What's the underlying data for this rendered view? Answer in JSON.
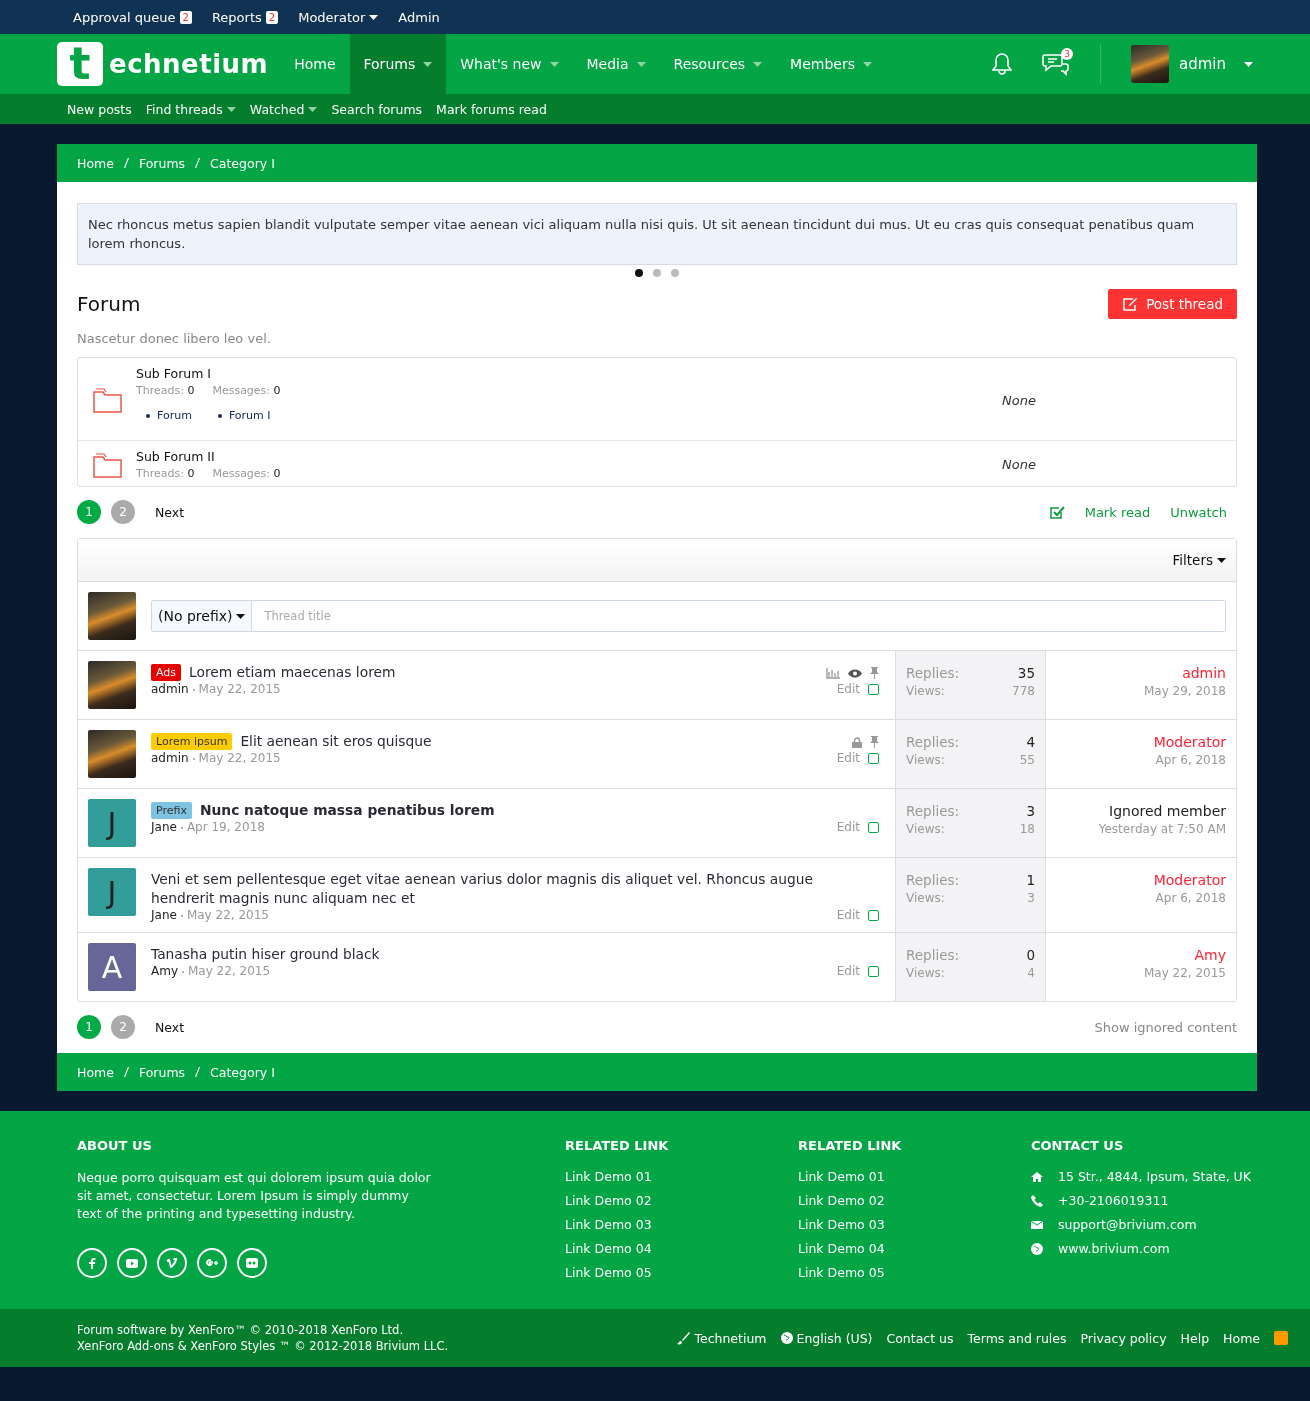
{
  "staff_bar": [
    {
      "label": "Approval queue",
      "badge": "2",
      "dropdown": false
    },
    {
      "label": "Reports",
      "badge": "2",
      "dropdown": false
    },
    {
      "label": "Moderator",
      "dropdown": true
    },
    {
      "label": "Admin",
      "dropdown": false
    }
  ],
  "header": {
    "logo_letter": "t",
    "logo_text": "echnetium",
    "nav": [
      {
        "label": "Home",
        "selected": false,
        "dropdown": false
      },
      {
        "label": "Forums",
        "selected": true,
        "dropdown": true
      },
      {
        "label": "What's new",
        "selected": false,
        "dropdown": true
      },
      {
        "label": "Media",
        "selected": false,
        "dropdown": true
      },
      {
        "label": "Resources",
        "selected": false,
        "dropdown": true
      },
      {
        "label": "Members",
        "selected": false,
        "dropdown": true
      }
    ],
    "conversations_badge": "3",
    "user": "admin"
  },
  "subnav": [
    {
      "label": "New posts",
      "dropdown": false
    },
    {
      "label": "Find threads",
      "dropdown": true
    },
    {
      "label": "Watched",
      "dropdown": true
    },
    {
      "label": "Search forums",
      "dropdown": false
    },
    {
      "label": "Mark forums read",
      "dropdown": false
    }
  ],
  "breadcrumb_top": [
    "Home",
    "Forums",
    "Category I"
  ],
  "notice": {
    "text": "Nec rhoncus metus sapien blandit vulputate semper vitae aenean vici aliquam nulla nisi quis. Ut sit aenean tincidunt dui mus. Ut eu cras quis consequat penatibus quam lorem rhoncus.",
    "dots": [
      {
        "selected": true
      },
      {
        "selected": false
      },
      {
        "selected": false
      }
    ]
  },
  "forum": {
    "title": "Forum",
    "description": "Nascetur donec libero leo vel.",
    "post_button": "Post thread"
  },
  "subforums": [
    {
      "title": "Sub Forum I",
      "threads_label": "Threads:",
      "threads": "0",
      "messages_label": "Messages:",
      "messages": "0",
      "links": [
        "Forum",
        "Forum I"
      ],
      "last_post": "None"
    },
    {
      "title": "Sub Forum II",
      "threads_label": "Threads:",
      "threads": "0",
      "messages_label": "Messages:",
      "messages": "0",
      "last_post": "None"
    }
  ],
  "pagination_top": {
    "pages": [
      {
        "label": "1",
        "selected": true
      },
      {
        "label": "2",
        "selected": false
      }
    ],
    "next": "Next"
  },
  "actions": [
    "Mark read",
    "Unwatch"
  ],
  "filters": "Filters",
  "new_thread": {
    "prefix": "(No prefix)",
    "placeholder": "Thread title"
  },
  "threads": [
    {
      "avatar": {
        "kind": "photo"
      },
      "prefix": {
        "label": "Ads",
        "color": "#e60000"
      },
      "title": "Lorem etiam maecenas lorem",
      "unread": false,
      "author": "admin",
      "date": "May 22, 2015",
      "poll": true,
      "watched": true,
      "locked": false,
      "sticky": true,
      "edit": "Edit",
      "checked": false,
      "replies_label": "Replies:",
      "replies": "35",
      "views_label": "Views:",
      "views": "778",
      "last_user": "admin",
      "last_staff": true,
      "last_date": "May 29, 2018"
    },
    {
      "avatar": {
        "kind": "photo"
      },
      "prefix": {
        "label": "Lorem ipsum",
        "color": "#ffcc00"
      },
      "title": "Elit aenean sit eros quisque",
      "unread": false,
      "author": "admin",
      "date": "May 22, 2015",
      "poll": false,
      "watched": false,
      "locked": true,
      "sticky": true,
      "edit": "Edit",
      "checked": false,
      "replies_label": "Replies:",
      "replies": "4",
      "views_label": "Views:",
      "views": "55",
      "last_user": "Moderator",
      "last_staff": true,
      "last_date": "Apr 6, 2018"
    },
    {
      "avatar": {
        "kind": "letter",
        "letter": "J",
        "color": "#339e99"
      },
      "prefix": {
        "label": "Prefix",
        "color": "#7fc3e2"
      },
      "title": "Nunc natoque massa penatibus lorem",
      "unread": true,
      "author": "Jane",
      "date": "Apr 19, 2018",
      "poll": false,
      "watched": false,
      "locked": false,
      "sticky": false,
      "edit": "Edit",
      "checked": false,
      "replies_label": "Replies:",
      "replies": "3",
      "views_label": "Views:",
      "views": "18",
      "last_user": "Ignored member",
      "last_staff": false,
      "last_date": "Yesterday at 7:50 AM"
    },
    {
      "avatar": {
        "kind": "letter",
        "letter": "J",
        "color": "#339e99"
      },
      "title": "Veni et sem pellentesque eget vitae aenean varius dolor magnis dis aliquet vel. Rhoncus augue hendrerit magnis nunc aliquam nec et",
      "unread": false,
      "author": "Jane",
      "date": "May 22, 2015",
      "poll": false,
      "watched": false,
      "locked": false,
      "sticky": false,
      "edit": "Edit",
      "checked": false,
      "replies_label": "Replies:",
      "replies": "1",
      "views_label": "Views:",
      "views": "3",
      "last_user": "Moderator",
      "last_staff": true,
      "last_date": "Apr 6, 2018"
    },
    {
      "avatar": {
        "kind": "letter",
        "letter": "A",
        "color": "#666699"
      },
      "title": "Tanasha putin hiser ground black",
      "unread": false,
      "author": "Amy",
      "date": "May 22, 2015",
      "poll": false,
      "watched": false,
      "locked": false,
      "sticky": false,
      "edit": "Edit",
      "checked": false,
      "replies_label": "Replies:",
      "replies": "0",
      "views_label": "Views:",
      "views": "4",
      "last_user": "Amy",
      "last_staff": true,
      "last_date": "May 22, 2015"
    }
  ],
  "pagination_bottom": {
    "pages": [
      {
        "label": "1",
        "selected": true
      },
      {
        "label": "2",
        "selected": false
      }
    ],
    "next": "Next"
  },
  "show_ignored": "Show ignored content",
  "breadcrumb_bottom": [
    "Home",
    "Forums",
    "Category I"
  ],
  "footer": {
    "about": {
      "title": "ABOUT US",
      "text": "Neque porro quisquam est qui dolorem ipsum quia dolor sit amet, consectetur. Lorem Ipsum is simply dummy text of the printing and typesetting industry."
    },
    "related": [
      {
        "title": "RELATED LINK",
        "links": [
          "Link Demo 01",
          "Link Demo 02",
          "Link Demo 03",
          "Link Demo 04",
          "Link Demo 05"
        ]
      },
      {
        "title": "RELATED LINK",
        "links": [
          "Link Demo 01",
          "Link Demo 02",
          "Link Demo 03",
          "Link Demo 04",
          "Link Demo 05"
        ]
      }
    ],
    "contact": {
      "title": "CONTACT US",
      "items": [
        {
          "kind": "address",
          "text": "15 Str., 4844, Ipsum, State, UK"
        },
        {
          "kind": "phone",
          "text": "+30-2106019311"
        },
        {
          "kind": "email",
          "text": "support@brivium.com"
        },
        {
          "kind": "web",
          "text": "www.brivium.com"
        }
      ]
    }
  },
  "bottom_bar": {
    "copyright": [
      "Forum software by XenForo™ © 2010-2018 XenForo Ltd.",
      "XenForo Add-ons & XenForo Styles ™ © 2012-2018 Brivium LLC."
    ],
    "links": [
      {
        "kind": "style",
        "label": "Technetium"
      },
      {
        "kind": "language",
        "label": "English (US)"
      },
      {
        "kind": "plain",
        "label": "Contact us"
      },
      {
        "kind": "plain",
        "label": "Terms and rules"
      },
      {
        "kind": "plain",
        "label": "Privacy policy"
      },
      {
        "kind": "plain",
        "label": "Help"
      },
      {
        "kind": "plain",
        "label": "Home"
      }
    ]
  }
}
